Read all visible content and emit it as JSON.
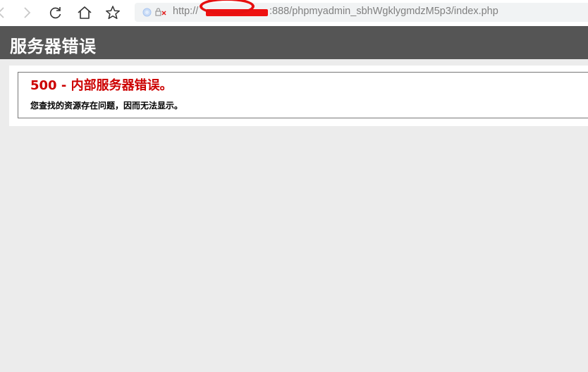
{
  "browser": {
    "back_icon": "chevron-left-icon",
    "forward_icon": "chevron-right-icon",
    "reload_icon": "reload-icon",
    "home_icon": "home-icon",
    "favorite_icon": "star-icon",
    "address": {
      "url": "http://                         :888/phpmyadmin_sbhWgklygmdzM5p3/index.php",
      "security_icon": "not-secure-lock-icon"
    },
    "redaction_color": "#e61010"
  },
  "page": {
    "header_title": "服务器错误",
    "header_bg": "#555555",
    "error_title": "500 - 内部服务器错误。",
    "error_title_color": "#cc0000",
    "error_message": "您查找的资源存在问题，因而无法显示。"
  }
}
